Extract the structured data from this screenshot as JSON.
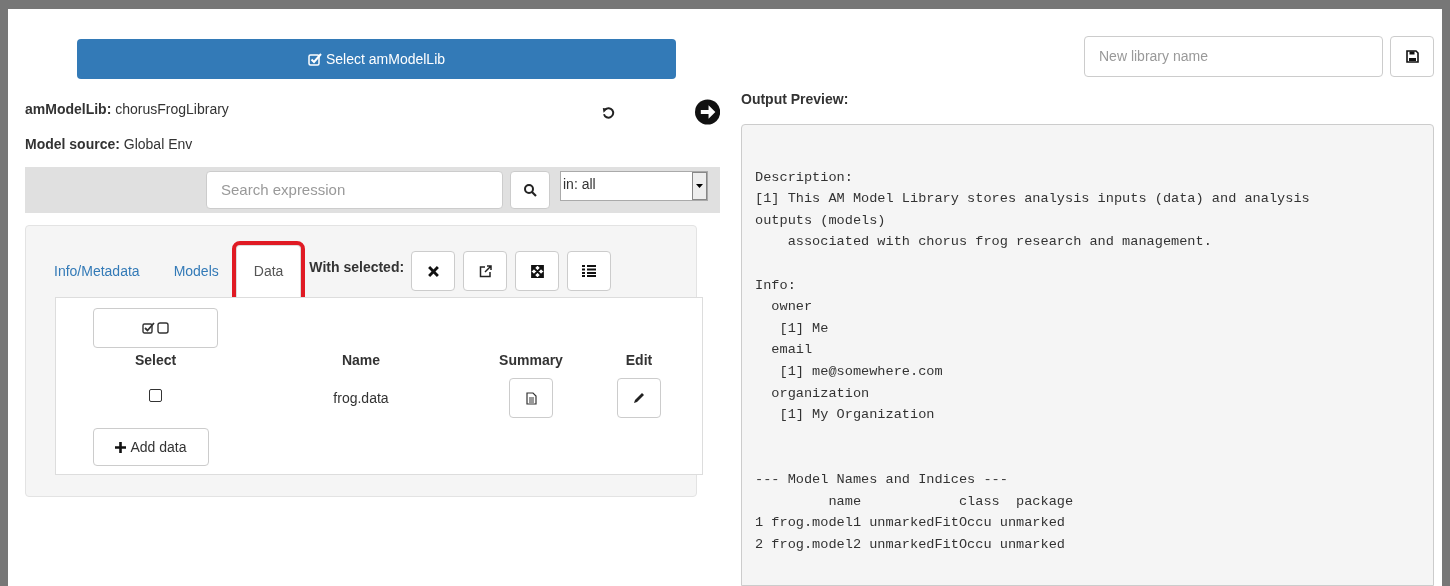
{
  "select_button": {
    "label": "Select amModelLib"
  },
  "library": {
    "label": "amModelLib:",
    "value": "chorusFrogLibrary"
  },
  "model_source": {
    "label": "Model source:",
    "value": "Global Env"
  },
  "search": {
    "placeholder": "Search expression",
    "scope": "in: all"
  },
  "tabs": [
    {
      "label": "Info/Metadata",
      "selected": false,
      "highlighted": false
    },
    {
      "label": "Models",
      "selected": false,
      "highlighted": false
    },
    {
      "label": "Data",
      "selected": true,
      "highlighted": true
    }
  ],
  "with_selected": {
    "label": "With selected:"
  },
  "table": {
    "columns": [
      "Select",
      "Name",
      "Summary",
      "Edit"
    ],
    "rows": [
      {
        "checked": false,
        "name": "frog.data"
      }
    ]
  },
  "add_button": {
    "label": "Add data"
  },
  "new_library": {
    "placeholder": "New library name"
  },
  "output_preview": {
    "title": "Output Preview:",
    "text": "\nDescription:\n[1] This AM Model Library stores analysis inputs (data) and analysis\noutputs (models)\n    associated with chorus frog research and management.\n\nInfo:\n  owner\n   [1] Me\n  email\n   [1] me@somewhere.com\n  organization\n   [1] My Organization\n\n\n--- Model Names and Indices ---\n         name            class  package\n1 frog.model1 unmarkedFitOccu unmarked\n2 frog.model2 unmarkedFitOccu unmarked"
  }
}
